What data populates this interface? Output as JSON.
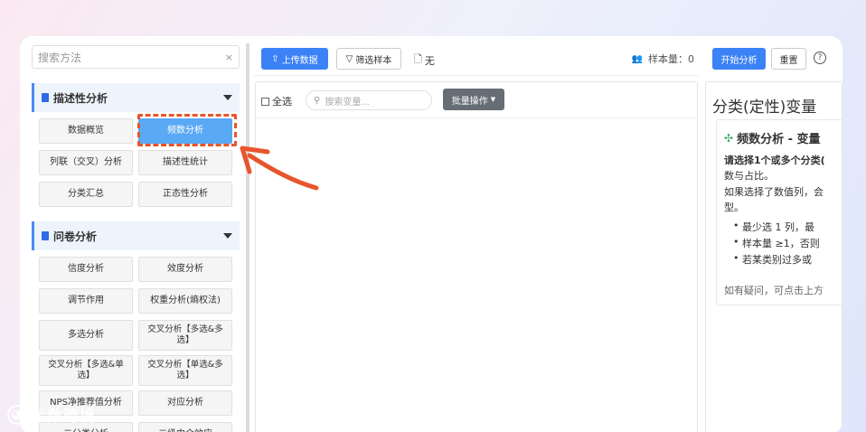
{
  "sidebar": {
    "search_placeholder": "搜索方法",
    "clear": "×",
    "groups": [
      {
        "label": "描述性分析",
        "items": [
          "数据概览",
          "频数分析",
          "列联（交叉）分析",
          "描述性统计",
          "分类汇总",
          "正态性分析"
        ]
      },
      {
        "label": "问卷分析",
        "items": [
          "信度分析",
          "效度分析",
          "调节作用",
          "权重分析(熵权法)",
          "多选分析",
          "交叉分析【多选&多选】",
          "交叉分析【多选&单选】",
          "交叉分析【单选&多选】",
          "NPS净推荐值分析",
          "对应分析",
          "二分类分析",
          "二级中介效应"
        ]
      }
    ],
    "active_item": "频数分析"
  },
  "toolbar": {
    "upload": "上传数据",
    "filter": "筛选样本",
    "file": "无",
    "sample_label": "样本量：",
    "sample_count": "0"
  },
  "varpanel": {
    "select_all": "全选",
    "search_placeholder": "搜索变量...",
    "batch": "批量操作"
  },
  "right": {
    "start": "开始分析",
    "reset": "重置",
    "help": "?",
    "section_title": "分类(定性)变量",
    "card_title": "频数分析 - 变量",
    "line1": "请选择1个或多个分类(",
    "line2": "数与占比。",
    "line3": "如果选择了数值列，会",
    "line4": "型。",
    "bullets": [
      "最少选 1 列，最",
      "样本量 ≥1，否则",
      "若某类别过多或"
    ],
    "note": "如有疑问，可点击上方"
  },
  "watermark": "大数跨境",
  "colors": {
    "primary": "#3b82f6",
    "active": "#5aa9f5",
    "highlight": "#e8552c"
  }
}
